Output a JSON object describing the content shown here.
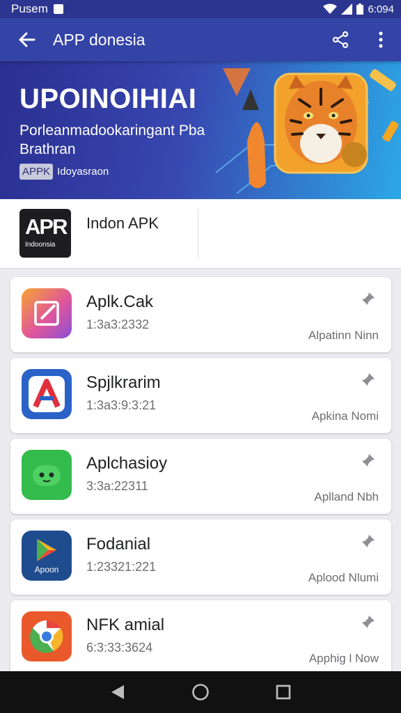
{
  "status_bar": {
    "carrier": "Pusem",
    "time": "6:094"
  },
  "app_bar": {
    "title": "APP donesia"
  },
  "banner": {
    "headline": "UPOINOIHIAI",
    "subtitle_line1": "Porleanmadookaringant Pba",
    "subtitle_line2": "Brathran",
    "tag": "APPK",
    "tag_text": "Idoyasraon"
  },
  "featured": {
    "logo_big": "APR",
    "logo_small": "Indoonsia",
    "name": "Indon APK"
  },
  "apps": [
    {
      "name": "Aplk.Cak",
      "meta": "1:3a3:2332",
      "link": "Alpatinn Ninn",
      "icon": "edit-app-icon",
      "color": "#e0569a"
    },
    {
      "name": "Spjlkrarim",
      "meta": "1:3a3:9:3:21",
      "link": "Apkina Nomi",
      "icon": "letter-a-app-icon",
      "color": "#2a62c8"
    },
    {
      "name": "Aplchasioy",
      "meta": "3:3a:22311",
      "link": "Aplland Nbh",
      "icon": "android-face-app-icon",
      "color": "#33bb4c"
    },
    {
      "name": "Fodanial",
      "meta": "1:23321:221",
      "link": "Aplood Nlumi",
      "icon": "play-store-app-icon",
      "color": "#1f4c8e"
    },
    {
      "name": "NFK amial",
      "meta": "6:3:33:3624",
      "link": "Apphig l Now",
      "icon": "chrome-app-icon",
      "color": "#e9592b"
    }
  ],
  "nav": {
    "back": "back-icon",
    "home": "home-icon",
    "recents": "recents-icon"
  }
}
